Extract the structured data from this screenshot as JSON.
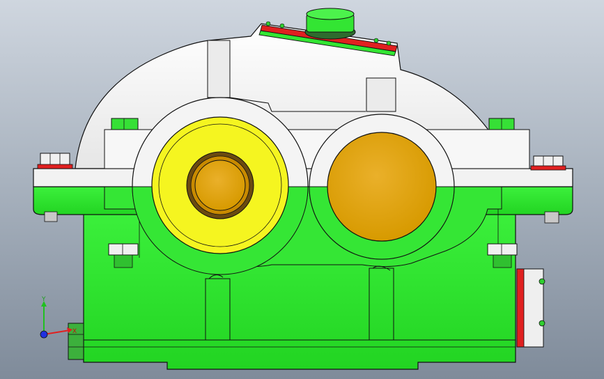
{
  "viewport": {
    "background_top": "#cfd6df",
    "background_bottom": "#7f8b9a"
  },
  "model": {
    "colors": {
      "base": "#33e533",
      "base_dark": "#1fb81f",
      "cover": "#f4f4f4",
      "cover_shade": "#d7d7d7",
      "bearing_ring": "#f5f520",
      "bearing_core": "#e0a000",
      "seal_red": "#e02020",
      "outline": "#1a1a1a"
    }
  },
  "triad": {
    "y_label": "Y",
    "x_label": "X",
    "y_color": "#20c020",
    "x_color": "#e02020",
    "z_color": "#2030e0"
  }
}
